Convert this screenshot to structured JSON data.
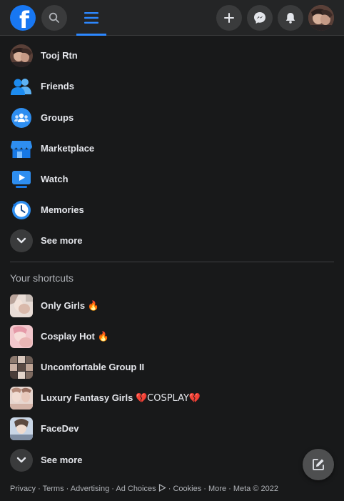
{
  "header": {
    "logo_icon": "facebook-logo-icon",
    "logo_glyph": "f",
    "search_icon": "search-icon",
    "menu_icon": "hamburger-menu-icon",
    "create_icon": "plus-icon",
    "messenger_icon": "messenger-icon",
    "notifications_icon": "bell-icon",
    "accent_color": "#2d88ff"
  },
  "nav": {
    "items": [
      {
        "label": "Tooj Rtn",
        "icon": "profile-avatar"
      },
      {
        "label": "Friends",
        "icon": "friends-icon"
      },
      {
        "label": "Groups",
        "icon": "groups-icon"
      },
      {
        "label": "Marketplace",
        "icon": "marketplace-icon"
      },
      {
        "label": "Watch",
        "icon": "watch-icon"
      },
      {
        "label": "Memories",
        "icon": "memories-icon"
      }
    ],
    "see_more": "See more"
  },
  "shortcuts": {
    "title": "Your shortcuts",
    "items": [
      {
        "label": "Only Girls",
        "suffix": "🔥"
      },
      {
        "label": "Cosplay Hot",
        "suffix": "🔥"
      },
      {
        "label": "Uncomfortable Group II",
        "suffix": ""
      },
      {
        "label": "Luxury Fantasy Girls",
        "suffix": "💔COSPLAY💔"
      },
      {
        "label": "FaceDev",
        "suffix": ""
      }
    ],
    "see_more": "See more"
  },
  "footer": {
    "links": [
      "Privacy",
      "Terms",
      "Advertising",
      "Ad Choices",
      "Cookies",
      "More"
    ],
    "separator": " · ",
    "copyright": "Meta © 2022"
  },
  "compose_icon": "compose-edit-icon"
}
